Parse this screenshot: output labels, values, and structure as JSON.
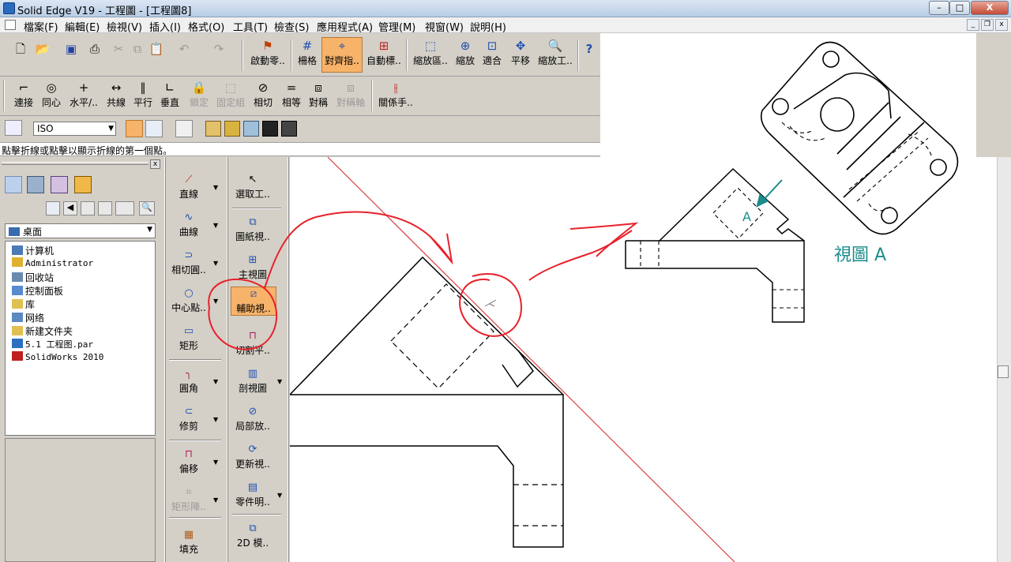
{
  "window": {
    "title": "Solid Edge V19 - 工程圖 - [工程圖8]",
    "min": "–",
    "max": "□",
    "close": "X"
  },
  "menu": [
    "檔案(F)",
    "編輯(E)",
    "檢視(V)",
    "插入(I)",
    "格式(O)",
    "工具(T)",
    "檢查(S)",
    "應用程式(A)",
    "管理(M)",
    "視窗(W)",
    "說明(H)"
  ],
  "toolbar1": {
    "part_hint": "啟動零..",
    "grid": "柵格",
    "align": "對齊指..",
    "auto": "自動標..",
    "zoom_area": "縮放區..",
    "zoom": "縮放",
    "fit": "適合",
    "pan": "平移",
    "zoom_tool": "縮放工..",
    "help_icon": "?"
  },
  "toolbar2": {
    "connect": "連接",
    "concentric": "同心",
    "horizontal": "水平/..",
    "collinear": "共線",
    "parallel": "平行",
    "perpendicular": "垂直",
    "lock": "鎖定",
    "fix_group": "固定組",
    "tangent": "相切",
    "equal": "相等",
    "symmetric": "對稱",
    "sym_axis": "對稱軸",
    "relation_helper": "關係手.."
  },
  "toolbar3": {
    "standard": "ISO"
  },
  "status_prompt": "點擊折線或點擊以顯示折線的第一個點。",
  "explorer": {
    "location": "桌面",
    "items": [
      {
        "label": "计算机",
        "mono": false
      },
      {
        "label": "Administrator",
        "mono": true
      },
      {
        "label": "回收站",
        "mono": false
      },
      {
        "label": "控制面板",
        "mono": false
      },
      {
        "label": "库",
        "mono": false
      },
      {
        "label": "网络",
        "mono": false
      },
      {
        "label": "新建文件夹",
        "mono": false
      },
      {
        "label": "5.1 工程图.par",
        "mono": true
      },
      {
        "label": "SolidWorks 2010",
        "mono": true
      }
    ]
  },
  "draw_tools": {
    "line": "直線",
    "curve": "曲線",
    "tangent_arc": "相切圓..",
    "center_point": "中心點..",
    "rectangle": "矩形",
    "fillet": "圓角",
    "trim": "修剪",
    "offset": "偏移",
    "rect_pattern": "矩形陣..",
    "fill": "填充"
  },
  "view_tools": {
    "select": "選取工..",
    "drawing_view": "圖紙視..",
    "principal": "主視圖",
    "auxiliary": "輔助視..",
    "cutting_plane": "切割平..",
    "section": "剖視圖",
    "detail": "局部放..",
    "update": "更新視..",
    "parts_list": "零件明..",
    "model_2d": "2D 模.."
  },
  "drawing": {
    "view_label": "視圖 A",
    "arrow_letter": "A",
    "annotation_color": "#e8212a",
    "label_color": "#1c8c8c"
  }
}
